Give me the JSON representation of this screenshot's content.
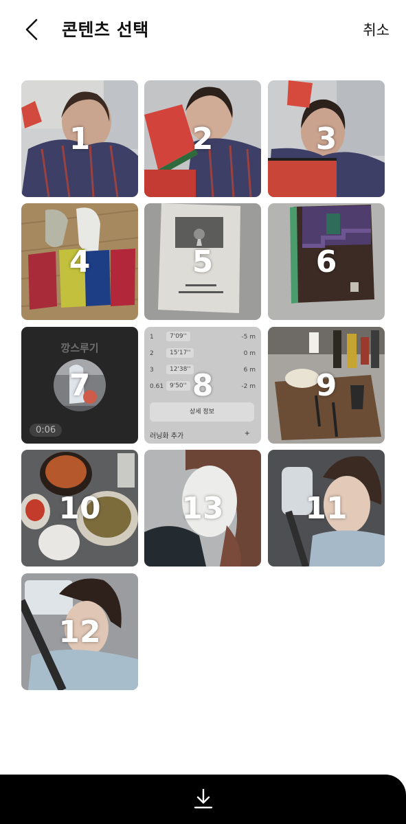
{
  "header": {
    "title": "콘텐츠 선택",
    "cancel_label": "취소"
  },
  "tiles": [
    {
      "number": "1"
    },
    {
      "number": "2"
    },
    {
      "number": "3"
    },
    {
      "number": "4"
    },
    {
      "number": "5"
    },
    {
      "number": "6"
    },
    {
      "number": "7",
      "title": "깡스루기",
      "duration": "0:06"
    },
    {
      "number": "8",
      "rows": [
        {
          "lap": "1",
          "pace": "7'09''",
          "elev": "-5 m"
        },
        {
          "lap": "2",
          "pace": "15'17''",
          "elev": "0 m"
        },
        {
          "lap": "3",
          "pace": "12'38''",
          "elev": "6 m"
        },
        {
          "lap": "0.61",
          "pace": "9'50''",
          "elev": "-2 m"
        }
      ],
      "detail_label": "상세 정보",
      "add_shoes_label": "러닝화 추가",
      "plus": "+"
    },
    {
      "number": "9"
    },
    {
      "number": "10"
    },
    {
      "number": "13"
    },
    {
      "number": "11"
    },
    {
      "number": "12"
    }
  ],
  "icons": {
    "back": "chevron-left-icon",
    "download": "download-icon"
  },
  "colors": {
    "background": "#ffffff",
    "bottom_bar": "#000000",
    "number_text": "#ffffff"
  }
}
